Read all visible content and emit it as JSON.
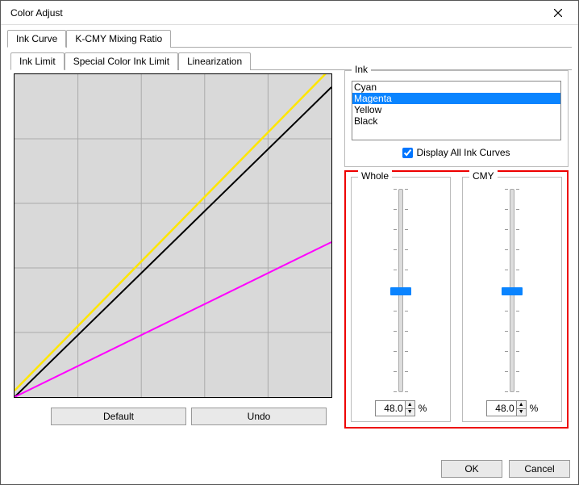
{
  "window": {
    "title": "Color Adjust"
  },
  "tabs_outer": {
    "items": [
      "Ink Curve",
      "K-CMY Mixing Ratio"
    ],
    "active_index": 0
  },
  "tabs_inner": {
    "items": [
      "Ink Limit",
      "Special Color Ink Limit",
      "Linearization"
    ],
    "active_index": 0
  },
  "ink_group": {
    "title": "Ink",
    "items": [
      {
        "label": "Cyan",
        "selected": false
      },
      {
        "label": "Magenta",
        "selected": true
      },
      {
        "label": "Yellow",
        "selected": false
      },
      {
        "label": "Black",
        "selected": false
      }
    ],
    "display_all_label": "Display All Ink Curves",
    "display_all_checked": true
  },
  "sliders": {
    "whole": {
      "title": "Whole",
      "value": "48.0",
      "unit": "%"
    },
    "cmy": {
      "title": "CMY",
      "value": "48.0",
      "unit": "%"
    }
  },
  "buttons": {
    "default": "Default",
    "undo": "Undo",
    "ok": "OK",
    "cancel": "Cancel"
  },
  "chart_data": {
    "type": "line",
    "xlim": [
      0,
      100
    ],
    "ylim": [
      0,
      100
    ],
    "grid": true,
    "series": [
      {
        "name": "Yellow",
        "color": "#ffff00",
        "points": [
          [
            0,
            0
          ],
          [
            100,
            100
          ]
        ],
        "offset_above": 2
      },
      {
        "name": "Black",
        "color": "#000000",
        "points": [
          [
            0,
            0
          ],
          [
            100,
            96
          ]
        ]
      },
      {
        "name": "Magenta",
        "color": "#ff00ff",
        "points": [
          [
            0,
            0
          ],
          [
            100,
            48
          ]
        ]
      }
    ]
  }
}
